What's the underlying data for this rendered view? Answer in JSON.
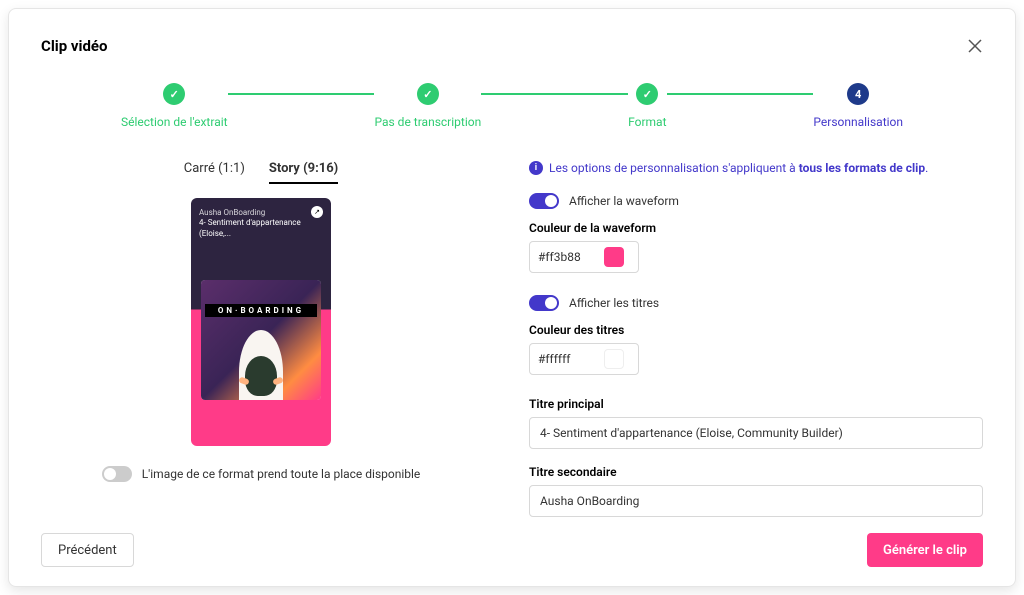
{
  "modal": {
    "title": "Clip vidéo"
  },
  "stepper": {
    "steps": [
      {
        "label": "Sélection de l'extrait"
      },
      {
        "label": "Pas de transcription"
      },
      {
        "label": "Format"
      },
      {
        "label": "Personnalisation",
        "number": "4"
      }
    ]
  },
  "left": {
    "tabs": {
      "carre": "Carré (1:1)",
      "story": "Story (9:16)"
    },
    "preview": {
      "line1": "Ausha OnBoarding",
      "line2": "4- Sentiment d'appartenance (Eloise,...",
      "onboarding_text": "ON·BOARDING"
    },
    "fullsize_toggle_label": "L'image de ce format prend toute la place disponible"
  },
  "right": {
    "info_text_prefix": "Les options de personnalisation s'appliquent à ",
    "info_text_bold": "tous les formats de clip",
    "info_text_suffix": ".",
    "waveform": {
      "toggle_label": "Afficher la waveform",
      "color_label": "Couleur de la waveform",
      "color_value": "#ff3b88",
      "swatch_color": "#ff3b88"
    },
    "titles": {
      "toggle_label": "Afficher les titres",
      "color_label": "Couleur des titres",
      "color_value": "#ffffff",
      "swatch_color": "#ffffff"
    },
    "main_title": {
      "label": "Titre principal",
      "value": "4- Sentiment d'appartenance (Eloise, Community Builder)"
    },
    "secondary_title": {
      "label": "Titre secondaire",
      "value": "Ausha OnBoarding"
    }
  },
  "footer": {
    "prev_label": "Précédent",
    "generate_label": "Générer le clip"
  }
}
